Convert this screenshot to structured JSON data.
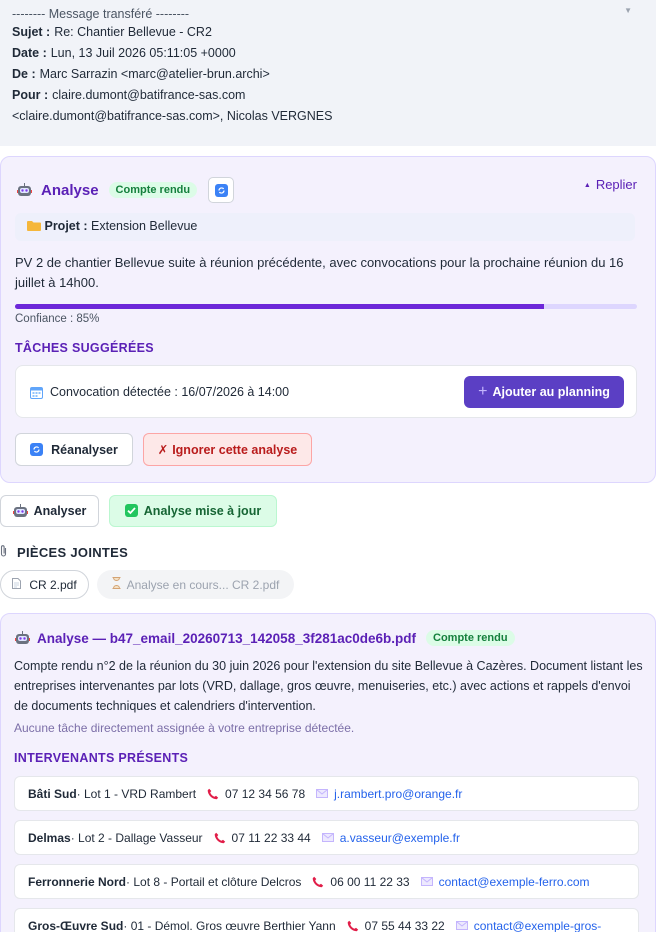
{
  "forwarded": {
    "separator": "-------- Message transféré --------",
    "subject_label": "Sujet :",
    "subject": "Re: Chantier Bellevue - CR2",
    "date_label": "Date :",
    "date": "Lun, 13 Juil 2026 05:11:05 +0000",
    "from_label": "De :",
    "from": "Marc Sarrazin <marc@atelier-brun.archi>",
    "to_label": "Pour :",
    "to": "claire.dumont@batifrance-sas.com",
    "to_cont": "<claire.dumont@batifrance-sas.com>, Nicolas VERGNES"
  },
  "analysis1": {
    "title": "Analyse",
    "badge": "Compte rendu",
    "collapse": "Replier",
    "project_label": "Projet :",
    "project": "Extension Bellevue",
    "summary": "PV 2 de chantier Bellevue suite à réunion précédente, avec convocations pour la prochaine réunion du 16 juillet à 14h00.",
    "confidence": 0.85,
    "confidence_label": "Confiance : 85%",
    "tasks_title": "TÂCHES SUGGÉRÉES",
    "task_text": "Convocation détectée : 16/07/2026 à 14:00",
    "add_button": "Ajouter au planning",
    "reanalyze_button": "Réanalyser",
    "ignore_button": "Ignorer cette analyse"
  },
  "actions": {
    "analyze_button": "Analyser",
    "updated_badge": "Analyse mise à jour"
  },
  "attachments": {
    "title": "PIÈCES JOINTES",
    "file": "CR 2.pdf",
    "pending": "Analyse en cours... CR 2.pdf"
  },
  "analysis2": {
    "title": "Analyse — b47_email_20260713_142058_3f281ac0de6b.pdf",
    "badge": "Compte rendu",
    "summary": "Compte rendu n°2 de la réunion du 30 juin 2026 pour l'extension du site Bellevue à Cazères. Document listant les entreprises intervenantes par lots (VRD, dallage, gros œuvre, menuiseries, etc.) avec actions et rappels d'envoi de documents techniques et calendriers d'intervention.",
    "no_task": "Aucune tâche directement assignée à votre entreprise détectée.",
    "people_title": "INTERVENANTS PRÉSENTS",
    "people": [
      {
        "company": "Bâti Sud",
        "lot": " · Lot 1 - VRD Rambert",
        "phone": "07 12 34 56 78",
        "email": "j.rambert.pro@orange.fr"
      },
      {
        "company": "Delmas",
        "lot": " · Lot 2 - Dallage Vasseur",
        "phone": "07 11 22 33 44",
        "email": "a.vasseur@exemple.fr"
      },
      {
        "company": "Ferronnerie Nord",
        "lot": " · Lot 8 - Portail et clôture Delcros",
        "phone": "06 00 11 22 33",
        "email": "contact@exemple-ferro.com"
      },
      {
        "company": "Gros-Œuvre Sud",
        "lot": " · 01 - Démol. Gros œuvre Berthier Yann",
        "phone": "07 55 44 33 22",
        "email": "contact@exemple-gros-"
      }
    ]
  },
  "colors": {
    "accent": "#5b21b6",
    "primary_button": "#5b3fc4",
    "card_bg": "#f4f1fd",
    "success_bg": "#dcfce7",
    "danger": "#b91c1c",
    "link": "#2563eb"
  }
}
